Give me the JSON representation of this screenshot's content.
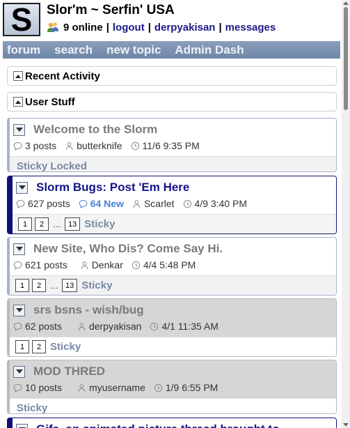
{
  "header": {
    "logo_letter": "S",
    "site_title": "Slor'm ~ Serfin' USA",
    "online": "9 online",
    "logout": "logout",
    "username": "derpyakisan",
    "messages": "messages",
    "separator": "|"
  },
  "nav": {
    "items": [
      {
        "label": "forum"
      },
      {
        "label": "search"
      },
      {
        "label": "new topic"
      },
      {
        "label": "Admin Dash"
      }
    ]
  },
  "sections": [
    {
      "label": "Recent Activity"
    },
    {
      "label": "User Stuff"
    }
  ],
  "topics": [
    {
      "title": "Welcome to the Slorm",
      "posts": "3 posts",
      "new": "",
      "author": "butterknife",
      "time": "11/6 9:35 PM",
      "pages": [],
      "tags": "Sticky Locked"
    },
    {
      "title": "Slorm Bugs: Post 'Em Here",
      "posts": "627 posts",
      "new": "64 New",
      "author": "Scarlet",
      "time": "4/9 3:40 PM",
      "pages": [
        "1",
        "2",
        "…",
        "13"
      ],
      "tags": "Sticky"
    },
    {
      "title": "New Site, Who Dis? Come Say Hi.",
      "posts": "621 posts",
      "new": "",
      "author": "Denkar",
      "time": "4/4 5:48 PM",
      "pages": [
        "1",
        "2",
        "…",
        "13"
      ],
      "tags": "Sticky"
    },
    {
      "title": "srs bsns - wish/bug",
      "posts": "62 posts",
      "new": "",
      "author": "derpyakisan",
      "time": "4/1 11:35 AM",
      "pages": [
        "1",
        "2"
      ],
      "tags": "Sticky"
    },
    {
      "title": "MOD THRED",
      "posts": "10 posts",
      "new": "",
      "author": "myusername",
      "time": "1/9 6:55 PM",
      "pages": [],
      "tags": "Sticky"
    },
    {
      "title": "Gifs, an animated picture thread brought to",
      "posts": "",
      "new": "",
      "author": "",
      "time": "",
      "pages": [],
      "tags": ""
    }
  ],
  "colors": {
    "nav_bg": "#7d93b2",
    "active_border": "#10107a",
    "link": "#1a1a8a",
    "new_count": "#4c7fd8",
    "tag": "#7788a6"
  },
  "icons": {
    "users": "users-icon",
    "posts": "speech-bubble-icon",
    "new": "speech-bubble-icon",
    "author": "person-icon",
    "time": "clock-icon",
    "toggle": "collapse-toggle-icon"
  }
}
